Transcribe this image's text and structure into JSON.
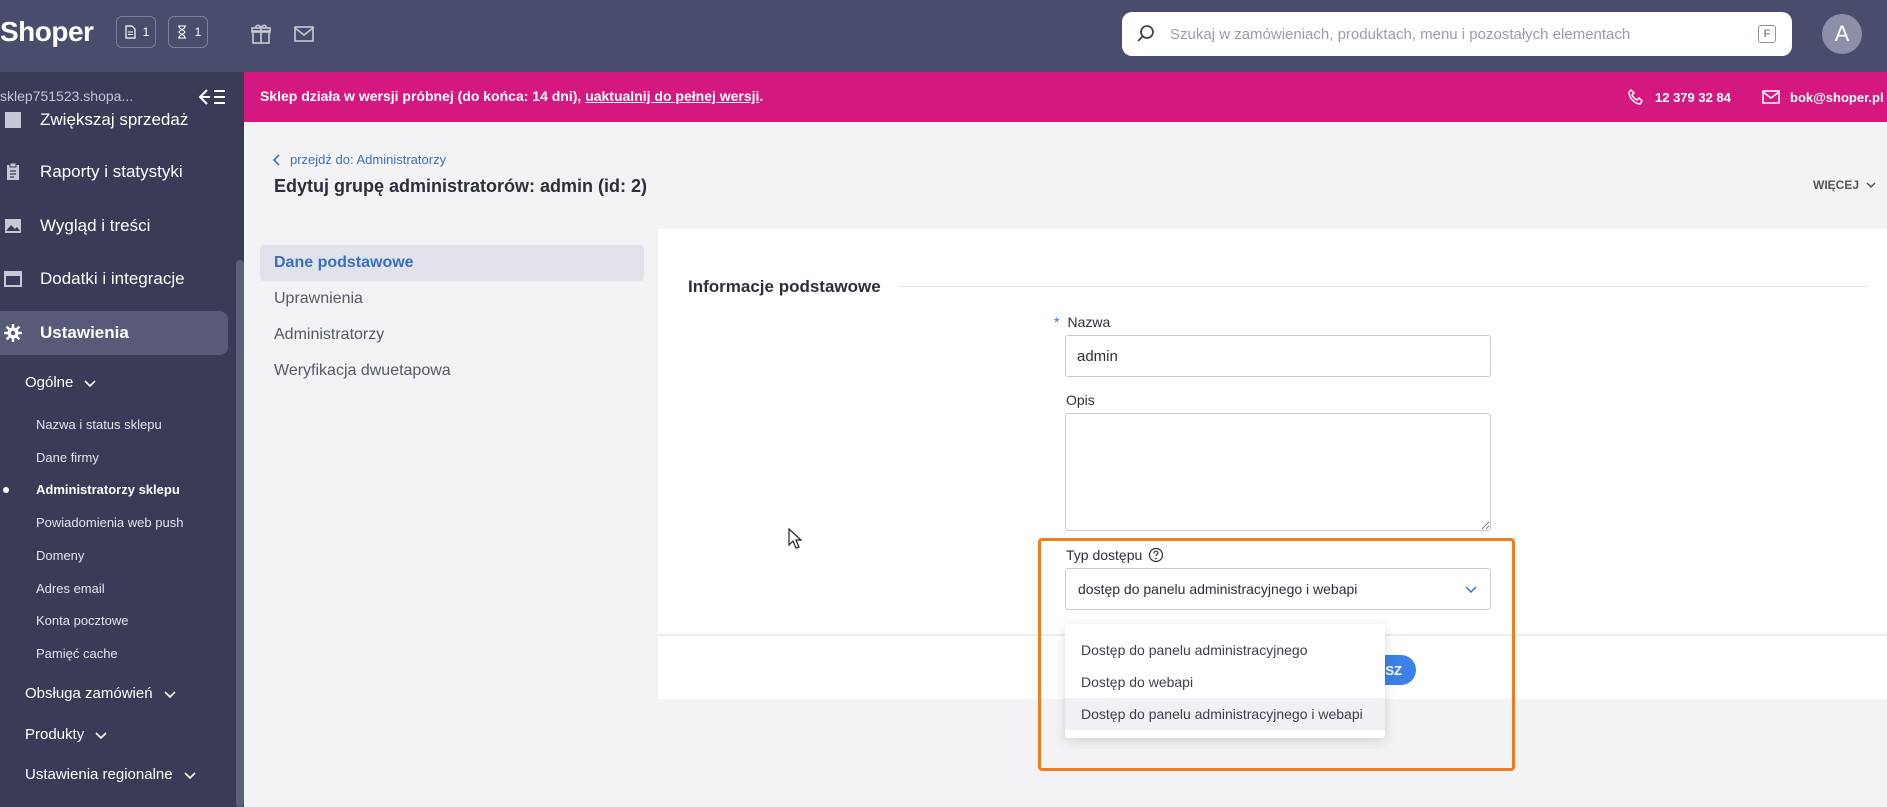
{
  "topbar": {
    "logo": "Shoper",
    "orders_count": "1",
    "pending_count": "1",
    "search_placeholder": "Szukaj w zamówieniach, produktach, menu i pozostałych elementach",
    "search_shortcut": "F",
    "avatar_letter": "A"
  },
  "sidebar": {
    "shop_name": "sklep751523.shopa...",
    "items": [
      {
        "label": "Zwiększaj sprzedaż",
        "icon": "growth-icon"
      },
      {
        "label": "Raporty i statystyki",
        "icon": "clipboard-icon"
      },
      {
        "label": "Wygląd i treści",
        "icon": "image-icon"
      },
      {
        "label": "Dodatki i integracje",
        "icon": "addons-icon"
      },
      {
        "label": "Ustawienia",
        "icon": "gear-icon"
      }
    ],
    "general_heading": "Ogólne",
    "general_items": [
      "Nazwa i status sklepu",
      "Dane firmy",
      "Administratorzy sklepu",
      "Powiadomienia web push",
      "Domeny",
      "Adres email",
      "Konta pocztowe",
      "Pamięć cache"
    ],
    "sections": [
      "Obsługa zamówień",
      "Produkty",
      "Ustawienia regionalne"
    ]
  },
  "banner": {
    "message": "Sklep działa w wersji próbnej (do końca: 14 dni), ",
    "link": "uaktualnij do pełnej wersji",
    "after_link": ".",
    "phone": "12 379 32 84",
    "email": "bok@shoper.pl",
    "color": "#d4187f"
  },
  "header": {
    "back_link": "przejdź do: Administratorzy",
    "title": "Edytuj grupę administratorów: admin (id: 2)",
    "more": "WIĘCEJ"
  },
  "tabs": [
    "Dane podstawowe",
    "Uprawnienia",
    "Administratorzy",
    "Weryfikacja dwuetapowa"
  ],
  "form": {
    "section_title": "Informacje podstawowe",
    "name_label": "Nazwa",
    "required_mark": "*",
    "name_value": "admin",
    "description_label": "Opis",
    "access_label": "Typ dostępu",
    "access_value": "dostęp do panelu administracyjnego i webapi",
    "access_options": [
      "Dostęp do panelu administracyjnego",
      "Dostęp do webapi",
      "Dostęp do panelu administracyjnego i webapi"
    ],
    "save_label": "SZ"
  },
  "colors": {
    "topbar": "#4a4c6d",
    "sidebar": "#393b57",
    "accent": "#3a6fc0",
    "highlight": "#f07c1e"
  }
}
